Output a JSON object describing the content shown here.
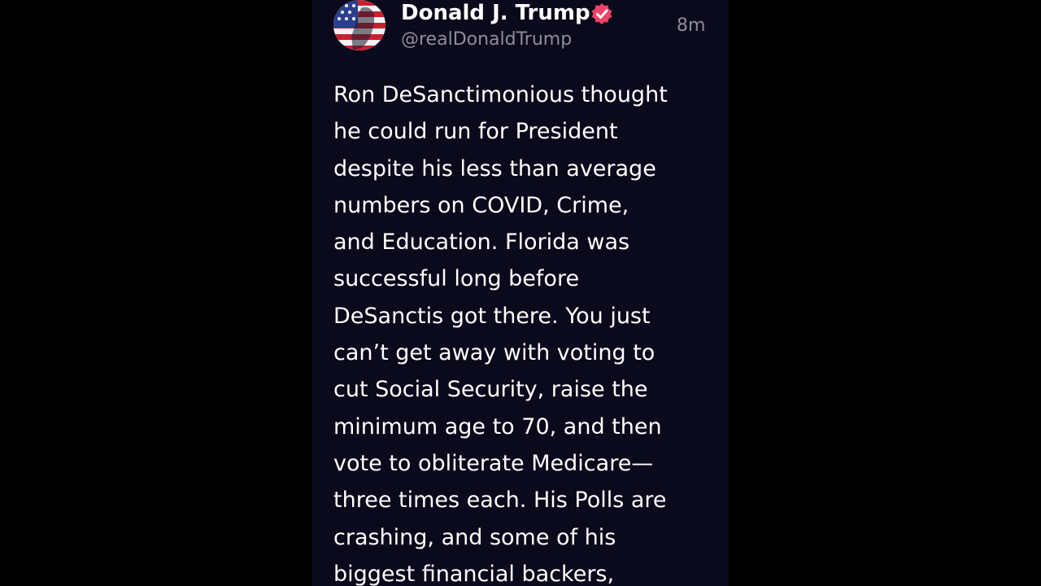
{
  "post": {
    "author": {
      "display_name": "Donald J. Trump",
      "handle": "@realDonaldTrump",
      "verified": true,
      "avatar_icon": "american-flag-portrait-avatar"
    },
    "timestamp": "8m",
    "body_lines": [
      "Ron DeSanctimonious thought",
      "he could run for President",
      "despite his less than average",
      "numbers on COVID, Crime,",
      "and Education. Florida was",
      "successful long before",
      "DeSanctis got there. You just",
      "can’t get away with voting to",
      "cut Social Security, raise the",
      "minimum age to 70, and then",
      "vote to obliterate Medicare—",
      "three times each. His Polls are",
      "crashing, and some of his",
      "biggest financial backers,"
    ]
  },
  "colors": {
    "page_background": "#000000",
    "post_background": "#0b0a1c",
    "text_primary": "#ffffff",
    "text_secondary": "#8e8d9e",
    "verified_badge": "#ee4466"
  }
}
